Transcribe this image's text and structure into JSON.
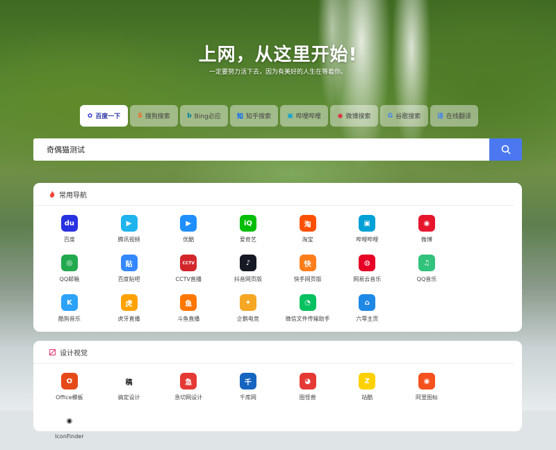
{
  "hero": {
    "title": "上网，从这里开始!",
    "subtitle": "一定要努力活下去，因为有美好的人生在等着你。"
  },
  "engines": [
    {
      "label": "百度一下",
      "icon": "baidu-paw-icon",
      "glyph": "✿",
      "color": "#2932e1",
      "active": true
    },
    {
      "label": "搜狗搜索",
      "icon": "sogou-icon",
      "glyph": "S",
      "color": "#fb6022",
      "active": false
    },
    {
      "label": "Bing必应",
      "icon": "bing-icon",
      "glyph": "b",
      "color": "#00809d",
      "active": false
    },
    {
      "label": "知乎搜索",
      "icon": "zhihu-icon",
      "glyph": "知",
      "color": "#0066ff",
      "active": false
    },
    {
      "label": "哔哩哔哩",
      "icon": "bilibili-icon",
      "glyph": "▣",
      "color": "#00a1d6",
      "active": false
    },
    {
      "label": "微博搜索",
      "icon": "weibo-icon",
      "glyph": "◉",
      "color": "#e6162d",
      "active": false
    },
    {
      "label": "谷歌搜索",
      "icon": "google-icon",
      "glyph": "G",
      "color": "#4285f4",
      "active": false
    },
    {
      "label": "在线翻译",
      "icon": "translate-icon",
      "glyph": "译",
      "color": "#3b82f6",
      "active": false
    }
  ],
  "search": {
    "value": "奇偶猫测试"
  },
  "sections": [
    {
      "title": "常用导航",
      "icon": "fire-icon",
      "sites": [
        {
          "label": "百度",
          "icon": "baidu-icon",
          "glyph": "du",
          "bg": "#2932e1"
        },
        {
          "label": "腾讯视频",
          "icon": "tencent-video-icon",
          "glyph": "▶",
          "bg": "#20b4ef"
        },
        {
          "label": "优酷",
          "icon": "youku-icon",
          "glyph": "▶",
          "bg": "#1f8fff"
        },
        {
          "label": "爱奇艺",
          "icon": "iqiyi-icon",
          "glyph": "iQ",
          "bg": "#00be06"
        },
        {
          "label": "淘宝",
          "icon": "taobao-icon",
          "glyph": "淘",
          "bg": "#ff5000"
        },
        {
          "label": "哔哩哔哩",
          "icon": "bilibili-icon",
          "glyph": "▣",
          "bg": "#00a1d6"
        },
        {
          "label": "微博",
          "icon": "weibo-icon",
          "glyph": "◉",
          "bg": "#e6162d"
        },
        {
          "label": "QQ邮箱",
          "icon": "qq-mail-icon",
          "glyph": "◎",
          "bg": "#22a94f"
        },
        {
          "label": "百度贴吧",
          "icon": "tieba-icon",
          "glyph": "贴",
          "bg": "#3388ff"
        },
        {
          "label": "CCTV直播",
          "icon": "cctv-icon",
          "glyph": "CCTV",
          "bg": "#d2262b"
        },
        {
          "label": "抖音网页版",
          "icon": "douyin-icon",
          "glyph": "♪",
          "bg": "#161823"
        },
        {
          "label": "快手网页版",
          "icon": "kuaishou-icon",
          "glyph": "快",
          "bg": "#ff7e1b"
        },
        {
          "label": "网易云音乐",
          "icon": "netease-music-icon",
          "glyph": "◍",
          "bg": "#e60026"
        },
        {
          "label": "QQ音乐",
          "icon": "qq-music-icon",
          "glyph": "♫",
          "bg": "#31c27c"
        },
        {
          "label": "酷狗音乐",
          "icon": "kugou-icon",
          "glyph": "K",
          "bg": "#2ca2f9"
        },
        {
          "label": "虎牙直播",
          "icon": "huya-icon",
          "glyph": "虎",
          "bg": "#ffa200"
        },
        {
          "label": "斗鱼直播",
          "icon": "douyu-icon",
          "glyph": "鱼",
          "bg": "#ff7700"
        },
        {
          "label": "企鹅电竞",
          "icon": "penguin-esports-icon",
          "glyph": "✦",
          "bg": "#f5a623"
        },
        {
          "label": "微信文件传输助手",
          "icon": "wechat-icon",
          "glyph": "◔",
          "bg": "#07c160"
        },
        {
          "label": "六零主页",
          "icon": "home-icon",
          "glyph": "⌂",
          "bg": "#1e88e5"
        }
      ]
    },
    {
      "title": "设计视觉",
      "icon": "design-icon",
      "sites": [
        {
          "label": "Office模板",
          "icon": "office-icon",
          "glyph": "O",
          "bg": "#e64a19"
        },
        {
          "label": "搞定设计",
          "icon": "gaoding-icon",
          "glyph": "稿",
          "bg": "#ffffff"
        },
        {
          "label": "急切网设计",
          "icon": "jiqie-icon",
          "glyph": "急",
          "bg": "#e53935"
        },
        {
          "label": "千库网",
          "icon": "qianku-icon",
          "glyph": "千",
          "bg": "#1565c0"
        },
        {
          "label": "图怪兽",
          "icon": "tuguaishou-icon",
          "glyph": "◕",
          "bg": "#e53935"
        },
        {
          "label": "站酷",
          "icon": "zcool-icon",
          "glyph": "Z",
          "bg": "#ffd100"
        },
        {
          "label": "阿里图标",
          "icon": "iconfont-icon",
          "glyph": "◉",
          "bg": "#f4511e"
        },
        {
          "label": "IconFinder",
          "icon": "iconfinder-icon",
          "glyph": "◉",
          "bg": "#ffffff"
        }
      ]
    }
  ]
}
